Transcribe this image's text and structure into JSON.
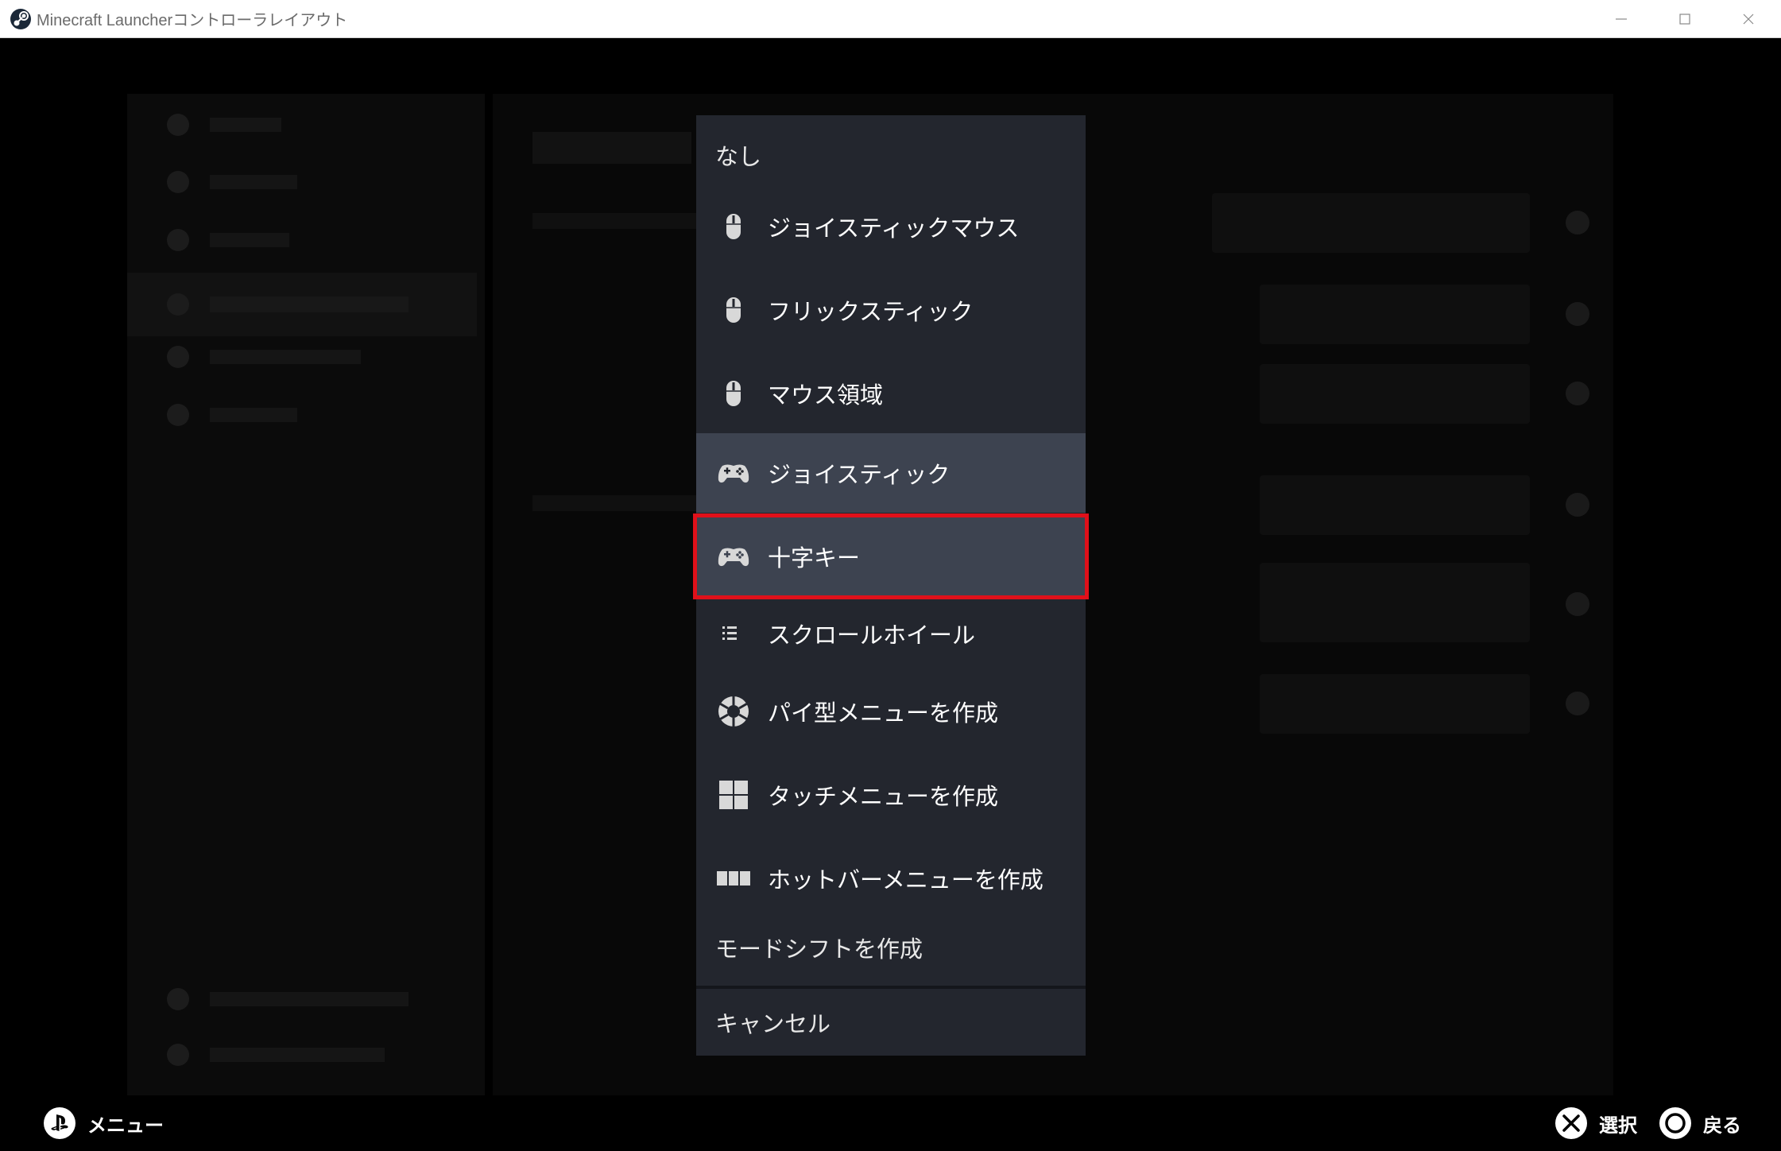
{
  "window": {
    "title": "Minecraft Launcherコントローラレイアウト",
    "icon": "steam-logo-icon"
  },
  "menu": {
    "items": [
      {
        "label": "なし",
        "icon": null
      },
      {
        "label": "ジョイスティックマウス",
        "icon": "mouse-icon"
      },
      {
        "label": "フリックスティック",
        "icon": "mouse-icon"
      },
      {
        "label": "マウス領域",
        "icon": "mouse-icon"
      },
      {
        "label": "ジョイスティック",
        "icon": "gamepad-icon",
        "state": "selected"
      },
      {
        "label": "十字キー",
        "icon": "gamepad-icon",
        "state": "focused"
      },
      {
        "label": "スクロールホイール",
        "icon": "list-icon"
      },
      {
        "label": "パイ型メニューを作成",
        "icon": "pie-menu-icon"
      },
      {
        "label": "タッチメニューを作成",
        "icon": "grid-icon"
      },
      {
        "label": "ホットバーメニューを作成",
        "icon": "hotbar-icon"
      },
      {
        "label": "モードシフトを作成",
        "icon": null
      }
    ],
    "cancel_label": "キャンセル"
  },
  "bottombar": {
    "menu_label": "メニュー",
    "select_label": "選択",
    "back_label": "戻る",
    "menu_icon": "playstation-icon",
    "select_icon": "cross-button-icon",
    "back_icon": "circle-button-icon"
  },
  "colors": {
    "menu_bg": "#23262e",
    "selected_bg": "#3d4350",
    "focus_outline": "#e0101a"
  }
}
